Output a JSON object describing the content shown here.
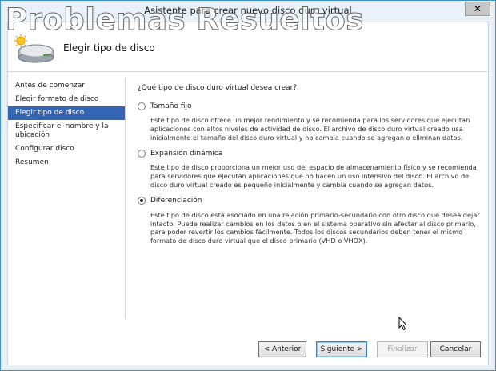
{
  "window": {
    "title": "Asistente para crear nuevo disco duro virtual",
    "close_symbol": "✕"
  },
  "watermark": "Problemas Resueltos",
  "header": {
    "title": "Elegir tipo de disco",
    "icon": "disk-wizard-icon"
  },
  "nav": {
    "items": [
      "Antes de comenzar",
      "Elegir formato de disco",
      "Elegir tipo de disco",
      "Especificar el nombre y la ubicación",
      "Configurar disco",
      "Resumen"
    ],
    "active_index": 2
  },
  "content": {
    "question": "¿Qué tipo de disco duro virtual desea crear?",
    "options": [
      {
        "label": "Tamaño fijo",
        "selected": false,
        "description": "Este tipo de disco ofrece un mejor rendimiento y se recomienda para los servidores que ejecutan aplicaciones con altos niveles de actividad de disco. El archivo de disco duro virtual creado usa inicialmente el tamaño del disco duro virtual y no cambia cuando se agregan o eliminan datos."
      },
      {
        "label": "Expansión dinámica",
        "selected": false,
        "description": "Este tipo de disco proporciona un mejor uso del espacio de almacenamiento físico y se recomienda para servidores que ejecutan aplicaciones que no hacen un uso intensivo del disco. El archivo de disco duro virtual creado es pequeño inicialmente y cambia cuando se agregan datos."
      },
      {
        "label": "Diferenciación",
        "selected": true,
        "description": "Este tipo de disco está asociado en una relación primario-secundario con otro disco que desea dejar intacto. Puede realizar cambios en los datos o en el sistema operativo sin afectar al disco primario, para poder revertir los cambios fácilmente. Todos los discos secundarios deben tener el mismo formato de disco duro virtual que el disco primario (VHD o VHDX)."
      }
    ]
  },
  "buttons": {
    "previous": "< Anterior",
    "next": "Siguiente >",
    "finish": "Finalizar",
    "cancel": "Cancelar"
  },
  "colors": {
    "nav_active": "#3266b4",
    "window_border": "#3e8fcc"
  }
}
